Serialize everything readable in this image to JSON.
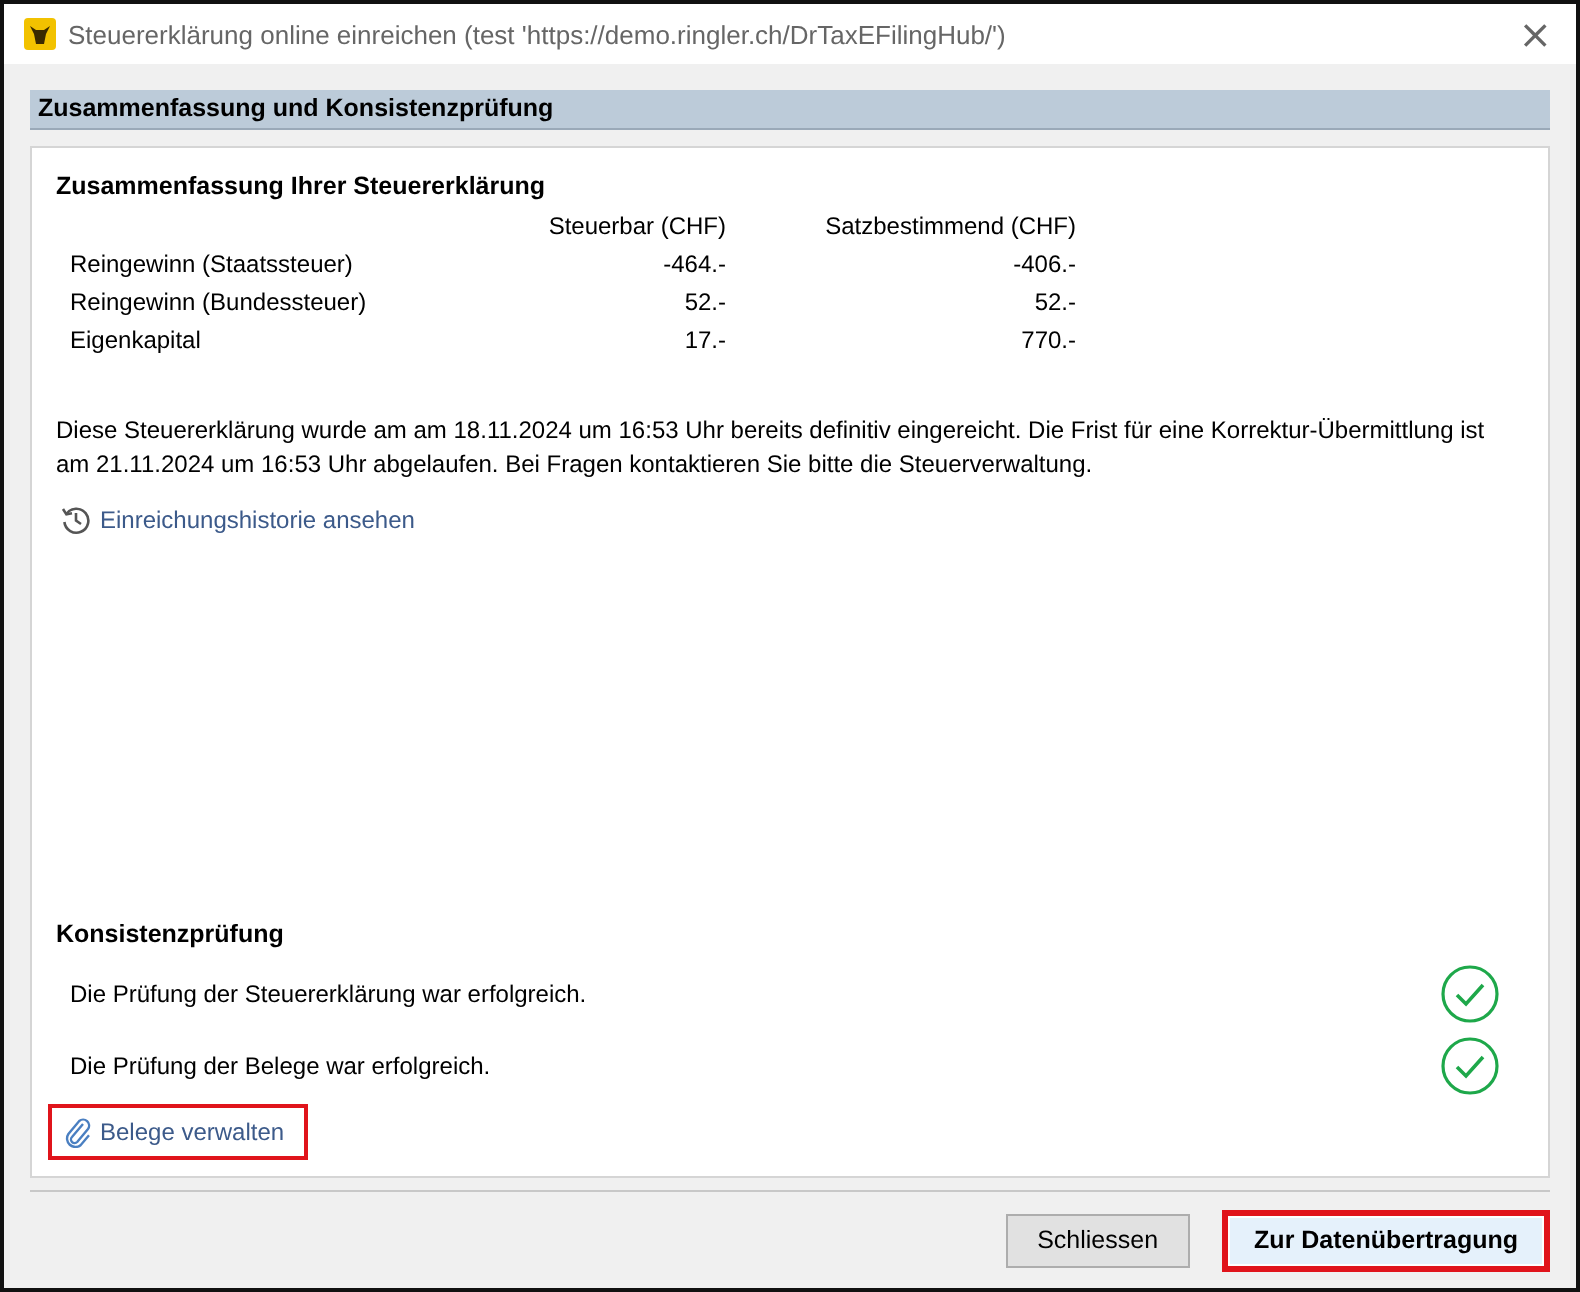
{
  "window": {
    "title": "Steuererklärung online einreichen (test 'https://demo.ringler.ch/DrTaxEFilingHub/')",
    "close": "×"
  },
  "section_header": "Zusammenfassung und Konsistenzprüfung",
  "summary": {
    "title": "Zusammenfassung Ihrer Steuererklärung",
    "columns": [
      "Steuerbar (CHF)",
      "Satzbestimmend (CHF)"
    ],
    "rows": [
      {
        "label": "Reingewinn (Staatssteuer)",
        "values": [
          "-464.-",
          "-406.-"
        ]
      },
      {
        "label": "Reingewinn (Bundessteuer)",
        "values": [
          "52.-",
          "52.-"
        ]
      },
      {
        "label": "Eigenkapital",
        "values": [
          "17.-",
          "770.-"
        ]
      }
    ]
  },
  "notice": "Diese Steuererklärung wurde am am 18.11.2024 um 16:53 Uhr bereits definitiv eingereicht. Die Frist für eine Korrektur-Übermittlung ist am 21.11.2024 um 16:53 Uhr abgelaufen. Bei Fragen kontaktieren Sie bitte die Steuerverwaltung.",
  "history_link": {
    "label": "Einreichungshistorie ansehen",
    "highlighted": false
  },
  "consistency": {
    "title": "Konsistenzprüfung",
    "checks": [
      {
        "text": "Die Prüfung der Steuererklärung war erfolgreich.",
        "passed": true
      },
      {
        "text": "Die Prüfung der Belege war erfolgreich.",
        "passed": true
      }
    ]
  },
  "documents_link": {
    "label": "Belege verwalten",
    "highlighted": true
  },
  "buttons": [
    {
      "label": "Schliessen",
      "primary": false,
      "highlighted": false
    },
    {
      "label": "Zur Datenübertragung",
      "primary": true,
      "highlighted": true
    }
  ]
}
